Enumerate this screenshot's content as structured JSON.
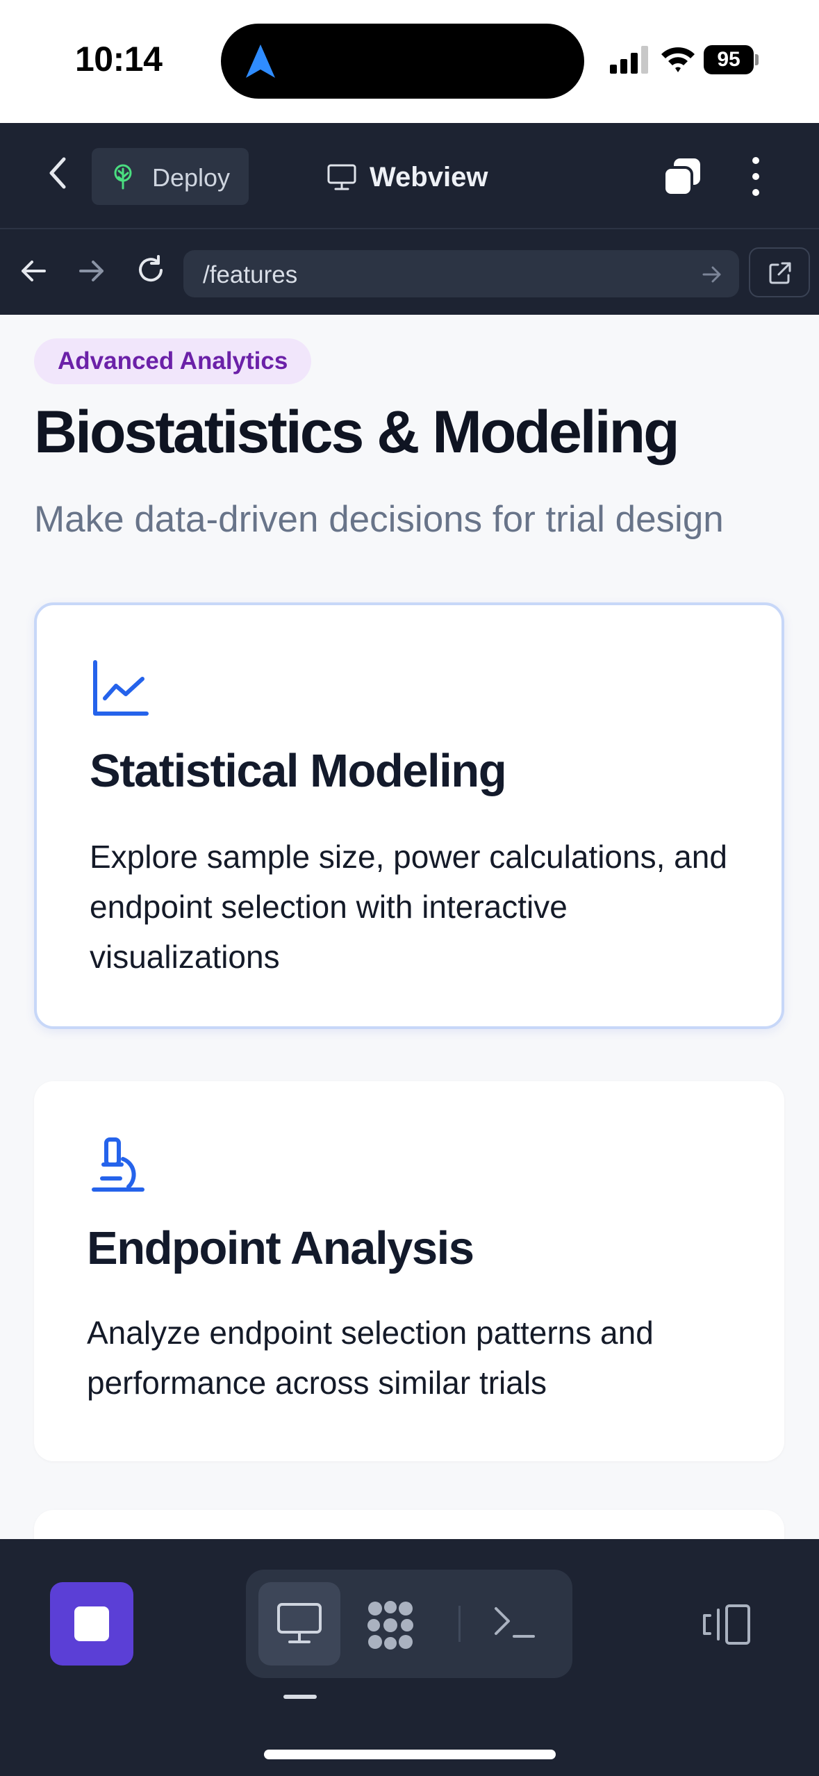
{
  "status_bar": {
    "time": "10:14",
    "battery": "95",
    "icons": [
      "location-arrow-icon",
      "signal-icon",
      "wifi-icon",
      "battery-icon"
    ]
  },
  "app_bar": {
    "back_icon": "chevron-left-icon",
    "deploy_label": "Deploy",
    "deploy_icon": "tree-icon",
    "title": "Webview",
    "title_icon": "monitor-icon",
    "tabs_icon": "tabs-icon",
    "more_icon": "more-vertical-icon"
  },
  "browser": {
    "url": "/features",
    "back_icon": "arrow-left-icon",
    "forward_icon": "arrow-right-icon",
    "reload_icon": "reload-icon",
    "go_icon": "arrow-right-icon",
    "external_icon": "external-link-icon"
  },
  "page": {
    "badge": "Advanced Analytics",
    "title": "Biostatistics & Modeling",
    "subtitle": "Make data-driven decisions for trial design",
    "cards": [
      {
        "icon": "line-chart-icon",
        "title": "Statistical Modeling",
        "description": "Explore sample size, power calculations, and endpoint selection with interactive visualizations"
      },
      {
        "icon": "microscope-icon",
        "title": "Endpoint Analysis",
        "description": "Analyze endpoint selection patterns and performance across similar trials"
      }
    ]
  },
  "bottom_bar": {
    "stop_icon": "stop-icon",
    "modes": [
      "monitor-icon",
      "grid-icon",
      "terminal-icon"
    ],
    "active_mode": "monitor-icon",
    "rotate_icon": "rotate-device-icon"
  },
  "colors": {
    "app_bar_bg": "#1d2332",
    "accent_purple": "#5b3fd6",
    "badge_bg": "#f1e6fb",
    "badge_text": "#6b21a8",
    "icon_blue": "#2563eb",
    "card_highlight_border": "#c7d7f8"
  }
}
